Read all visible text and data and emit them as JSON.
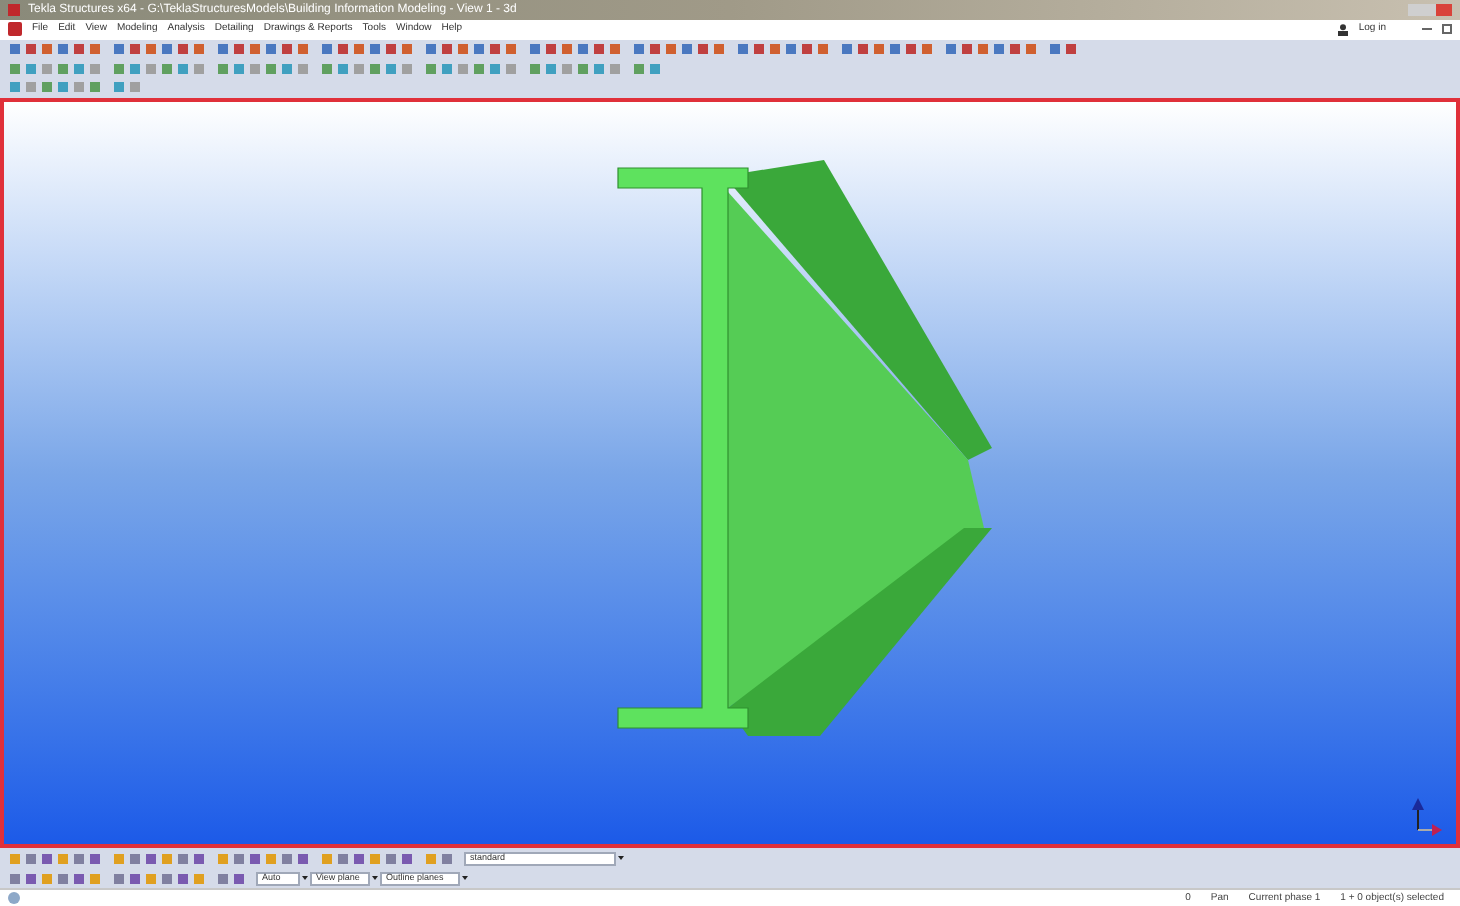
{
  "window": {
    "title": "Tekla Structures x64 - G:\\TeklaStructuresModels\\Building Information Modeling - View 1 - 3d"
  },
  "menu": [
    "File",
    "Edit",
    "View",
    "Modeling",
    "Analysis",
    "Detailing",
    "Drawings & Reports",
    "Tools",
    "Window",
    "Help"
  ],
  "account": {
    "label": "Log in"
  },
  "bottom_toolbar": {
    "selection_filter": "standard",
    "dropdowns": [
      "Auto",
      "View plane",
      "Outline planes"
    ]
  },
  "status_bar": [
    "0",
    "Pan",
    "Current phase 1",
    "1 + 0 object(s) selected"
  ]
}
